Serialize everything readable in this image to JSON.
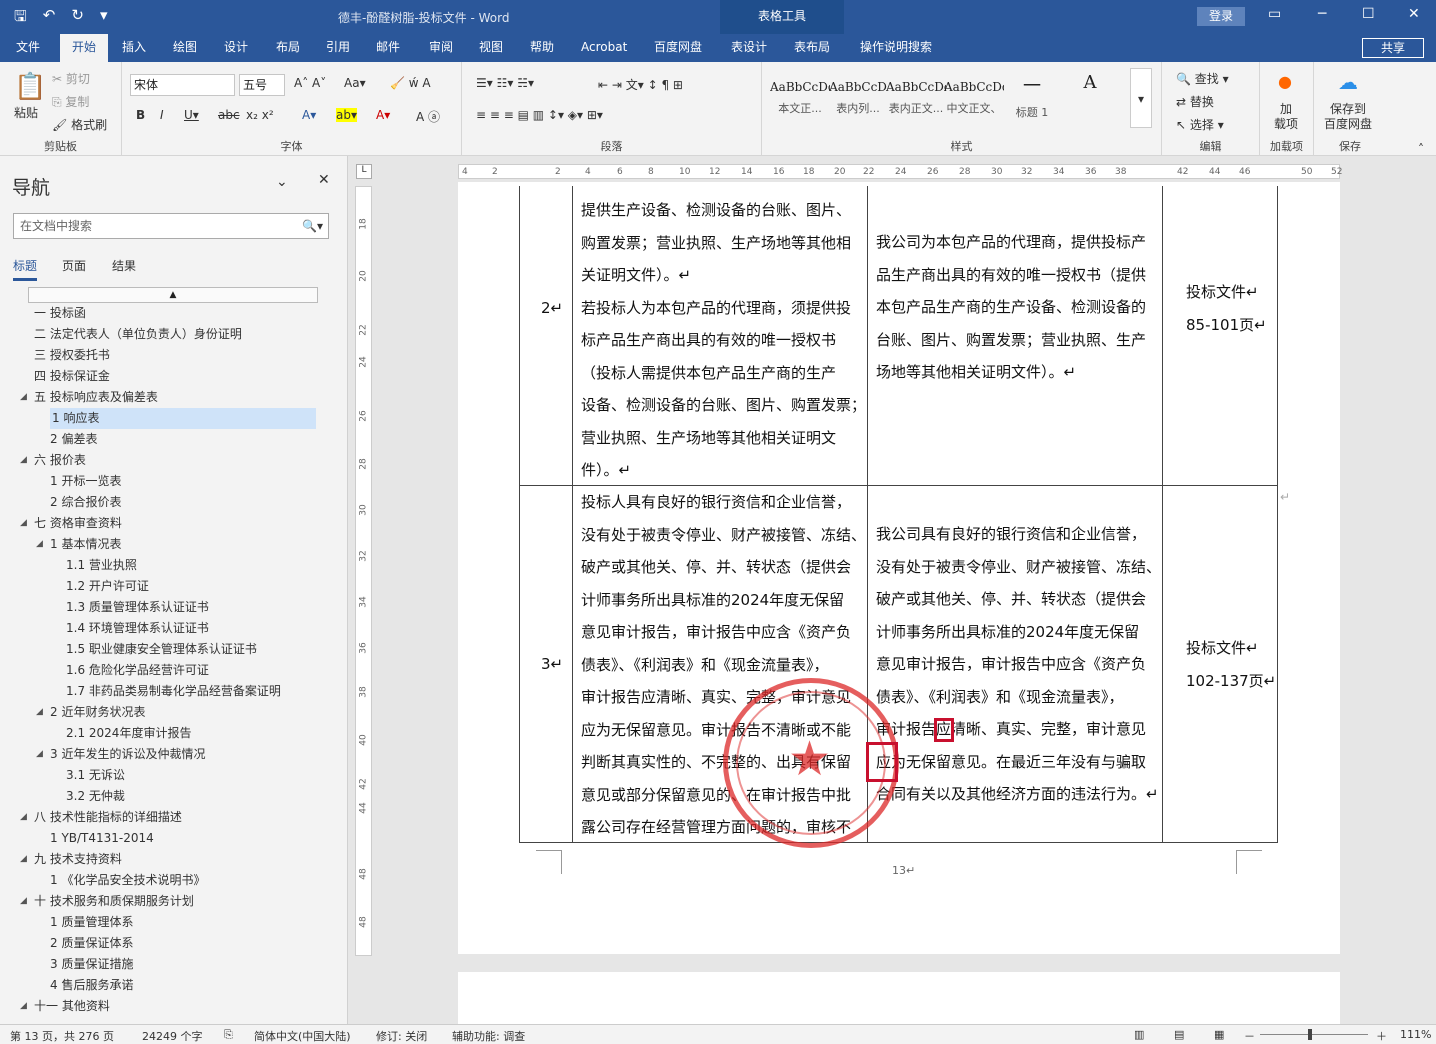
{
  "window": {
    "title": "德丰-酚醛树脂-投标文件  -  Word",
    "context_tab": "表格工具",
    "signin": "登录",
    "share": "共享"
  },
  "tabs": [
    "文件",
    "开始",
    "插入",
    "绘图",
    "设计",
    "布局",
    "引用",
    "邮件",
    "审阅",
    "视图",
    "帮助",
    "Acrobat",
    "百度网盘",
    "表设计",
    "表布局",
    "操作说明搜索"
  ],
  "ribbon": {
    "clipboard": {
      "paste": "粘贴",
      "cut": "剪切",
      "copy": "复制",
      "painter": "格式刷",
      "label": "剪贴板"
    },
    "font": {
      "name": "宋体",
      "size": "五号",
      "label": "字体"
    },
    "paragraph": {
      "label": "段落"
    },
    "styles": {
      "items": [
        {
          "preview": "AaBbCcDdI",
          "name": "本文正..."
        },
        {
          "preview": "AaBbCcD",
          "name": "表内列..."
        },
        {
          "preview": "AaBbCcDd",
          "name": "表内正文..."
        },
        {
          "preview": "AaBbCcDd",
          "name": "中文正文、"
        },
        {
          "preview": "一",
          "name": "标题 1"
        },
        {
          "preview": "A",
          "name": ""
        }
      ],
      "label": "样式"
    },
    "editing": {
      "find": "查找",
      "replace": "替换",
      "select": "选择",
      "label": "编辑"
    },
    "addins": {
      "load": "加\n载项",
      "label": "加载项"
    },
    "save": {
      "btn": "保存到\n百度网盘",
      "label": "保存"
    }
  },
  "nav": {
    "title": "导航",
    "search_placeholder": "在文档中搜索",
    "tabs": [
      "标题",
      "页面",
      "结果"
    ],
    "items": [
      {
        "t": "一 投标函",
        "l": 1
      },
      {
        "t": "二 法定代表人（单位负责人）身份证明",
        "l": 1
      },
      {
        "t": "三 授权委托书",
        "l": 1
      },
      {
        "t": "四 投标保证金",
        "l": 1
      },
      {
        "t": "五 投标响应表及偏差表",
        "l": 1,
        "exp": true
      },
      {
        "t": "1 响应表",
        "l": 2,
        "sel": true
      },
      {
        "t": "2 偏差表",
        "l": 2
      },
      {
        "t": "六 报价表",
        "l": 1,
        "exp": true
      },
      {
        "t": "1 开标一览表",
        "l": 2
      },
      {
        "t": "2 综合报价表",
        "l": 2
      },
      {
        "t": "七 资格审查资料",
        "l": 1,
        "exp": true
      },
      {
        "t": "1 基本情况表",
        "l": 2,
        "exp": true
      },
      {
        "t": "1.1 营业执照",
        "l": 3
      },
      {
        "t": "1.2 开户许可证",
        "l": 3
      },
      {
        "t": "1.3 质量管理体系认证证书",
        "l": 3
      },
      {
        "t": "1.4 环境管理体系认证证书",
        "l": 3
      },
      {
        "t": "1.5 职业健康安全管理体系认证证书",
        "l": 3
      },
      {
        "t": "1.6 危险化学品经营许可证",
        "l": 3
      },
      {
        "t": "1.7 非药品类易制毒化学品经营备案证明",
        "l": 3
      },
      {
        "t": "2 近年财务状况表",
        "l": 2,
        "exp": true
      },
      {
        "t": "2.1 2024年度审计报告",
        "l": 3
      },
      {
        "t": "3 近年发生的诉讼及仲裁情况",
        "l": 2,
        "exp": true
      },
      {
        "t": "3.1 无诉讼",
        "l": 3
      },
      {
        "t": "3.2 无仲裁",
        "l": 3
      },
      {
        "t": "八 技术性能指标的详细描述",
        "l": 1,
        "exp": true
      },
      {
        "t": "1 YB/T4131-2014",
        "l": 2
      },
      {
        "t": "九 技术支持资料",
        "l": 1,
        "exp": true
      },
      {
        "t": "1 《化学品安全技术说明书》",
        "l": 2
      },
      {
        "t": "十 技术服务和质保期服务计划",
        "l": 1,
        "exp": true
      },
      {
        "t": "1 质量管理体系",
        "l": 2
      },
      {
        "t": "2 质量保证体系",
        "l": 2
      },
      {
        "t": "3 质量保证措施",
        "l": 2
      },
      {
        "t": "4 售后服务承诺",
        "l": 2
      },
      {
        "t": "十一 其他资料",
        "l": 1,
        "exp": true
      }
    ]
  },
  "table": {
    "rows": [
      {
        "no": "2↵",
        "req": [
          "提供生产设备、检测设备的台账、图片、",
          "购置发票；营业执照、生产场地等其他相",
          "关证明文件）。↵",
          "若投标人为本包产品的代理商，须提供投",
          "标产品生产商出具的有效的唯一授权书",
          "（投标人需提供本包产品生产商的生产",
          "设备、检测设备的台账、图片、购置发票；",
          "营业执照、生产场地等其他相关证明文",
          "件）。↵"
        ],
        "resp": [
          "我公司为本包产品的代理商，提供投标产",
          "品生产商出具的有效的唯一授权书（提供",
          "本包产品生产商的生产设备、检测设备的",
          "台账、图片、购置发票；营业执照、生产",
          "场地等其他相关证明文件）。↵"
        ],
        "ref": [
          "投标文件↵",
          "85-101页↵"
        ]
      },
      {
        "no": "3↵",
        "req": [
          "投标人具有良好的银行资信和企业信誉，",
          "没有处于被责令停业、财产被接管、冻结、",
          "破产或其他关、停、并、转状态（提供会",
          "计师事务所出具标准的2024年度无保留",
          "意见审计报告，审计报告中应含《资产负",
          "债表》、《利润表》和《现金流量表》，",
          "审计报告应清晰、真实、完整，审计意见",
          "应为无保留意见。审计报告不清晰或不能",
          "判断其真实性的、不完整的、出具有保留",
          "意见或部分保留意见的、在审计报告中批",
          "露公司存在经营管理方面问题的，审核不"
        ],
        "resp": [
          "我公司具有良好的银行资信和企业信誉，",
          "没有处于被责令停业、财产被接管、冻结、",
          "破产或其他关、停、并、转状态（提供会",
          "计师事务所出具标准的2024年度无保留",
          "意见审计报告，审计报告中应含《资产负",
          "债表》、《利润表》和《现金流量表》，",
          "审计报告应清晰、真实、完整，审计意见",
          "应为无保留意见。在最近三年没有与骗取",
          "合同有关以及其他经济方面的违法行为。↵"
        ],
        "ref": [
          "投标文件↵",
          "102-137页↵"
        ]
      }
    ]
  },
  "page_number": "13↵",
  "status": {
    "page": "第 13 页，共 276 页",
    "words": "24249 个字",
    "lang": "简体中文(中国大陆)",
    "track": "修订: 关闭",
    "access": "辅助功能: 调查",
    "zoom": "111%"
  },
  "ruler_h": [
    "4",
    "2",
    "2",
    "4",
    "6",
    "8",
    "10",
    "12",
    "14",
    "16",
    "18",
    "20",
    "22",
    "24",
    "26",
    "28",
    "30",
    "32",
    "34",
    "36",
    "38",
    "42",
    "44",
    "46",
    "50",
    "52"
  ],
  "ruler_v": [
    "18",
    "20",
    "22",
    "24",
    "26",
    "28",
    "30",
    "32",
    "34",
    "36",
    "38",
    "40",
    "42",
    "44",
    "48",
    "48"
  ]
}
